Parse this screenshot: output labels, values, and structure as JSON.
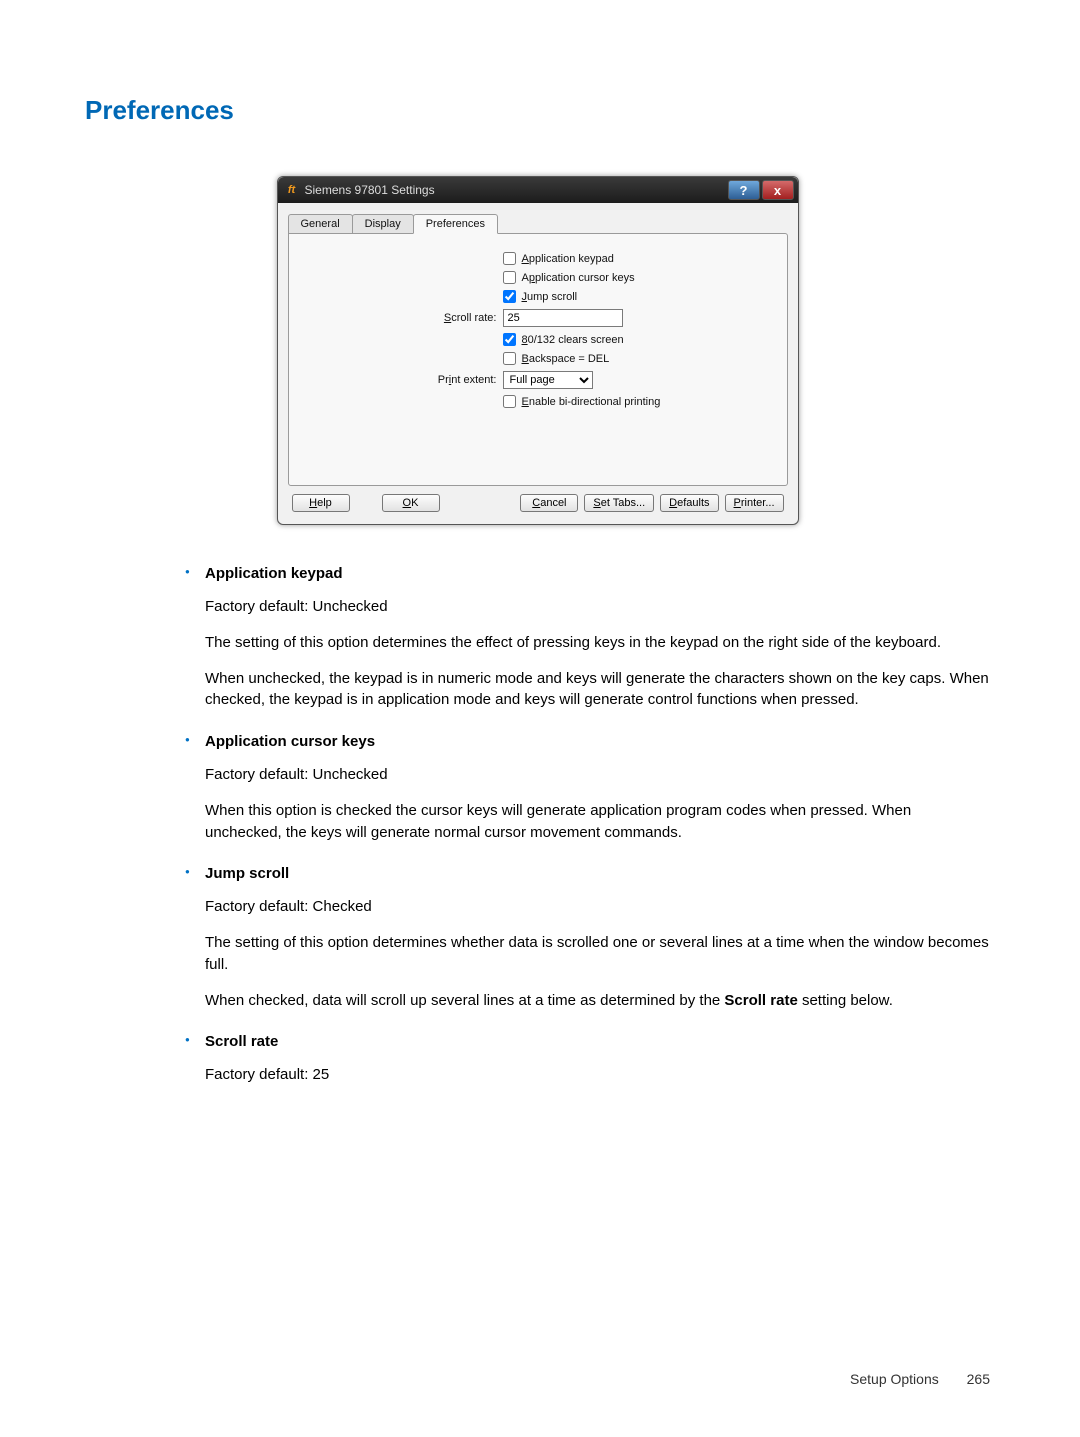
{
  "section_title": "Preferences",
  "dialog": {
    "title": "Siemens 97801 Settings",
    "tabs": [
      "General",
      "Display",
      "Preferences"
    ],
    "active_tab": 2,
    "form": {
      "app_keypad": {
        "label": "Application keypad",
        "checked": false
      },
      "app_cursor": {
        "label": "Application cursor keys",
        "checked": false
      },
      "jump_scroll": {
        "label": "Jump scroll",
        "checked": true
      },
      "scroll_rate": {
        "label": "Scroll rate:",
        "value": "25"
      },
      "clears_screen": {
        "label": "80/132 clears screen",
        "checked": true
      },
      "backspace_del": {
        "label": "Backspace = DEL",
        "checked": false
      },
      "print_extent": {
        "label": "Print extent:",
        "value": "Full page"
      },
      "bidir_print": {
        "label": "Enable bi-directional printing",
        "checked": false
      }
    },
    "buttons": {
      "help": "Help",
      "ok": "OK",
      "cancel": "Cancel",
      "set_tabs": "Set Tabs...",
      "defaults": "Defaults",
      "printer": "Printer..."
    }
  },
  "items": [
    {
      "title": "Application keypad",
      "paras": [
        "Factory default: Unchecked",
        "The setting of this option determines the effect of pressing keys in the keypad on the right side of the keyboard.",
        "When unchecked, the keypad is in numeric mode and keys will generate the characters shown on the key caps. When checked, the keypad is in application mode and keys will generate control functions when pressed."
      ]
    },
    {
      "title": "Application cursor keys",
      "paras": [
        "Factory default: Unchecked",
        "When this option is checked the cursor keys will generate application program codes when pressed. When unchecked, the keys will generate normal cursor movement commands."
      ]
    },
    {
      "title": "Jump scroll",
      "paras": [
        "Factory default: Checked",
        "The setting of this option determines whether data is scrolled one or several lines at a time when the window becomes full."
      ],
      "para_rich_prefix": "When checked, data will scroll up several lines at a time as determined by the ",
      "para_rich_bold": "Scroll rate",
      "para_rich_suffix": " setting below."
    },
    {
      "title": "Scroll rate",
      "paras": [
        "Factory default: 25"
      ]
    }
  ],
  "footer": {
    "label": "Setup Options",
    "page": "265"
  }
}
